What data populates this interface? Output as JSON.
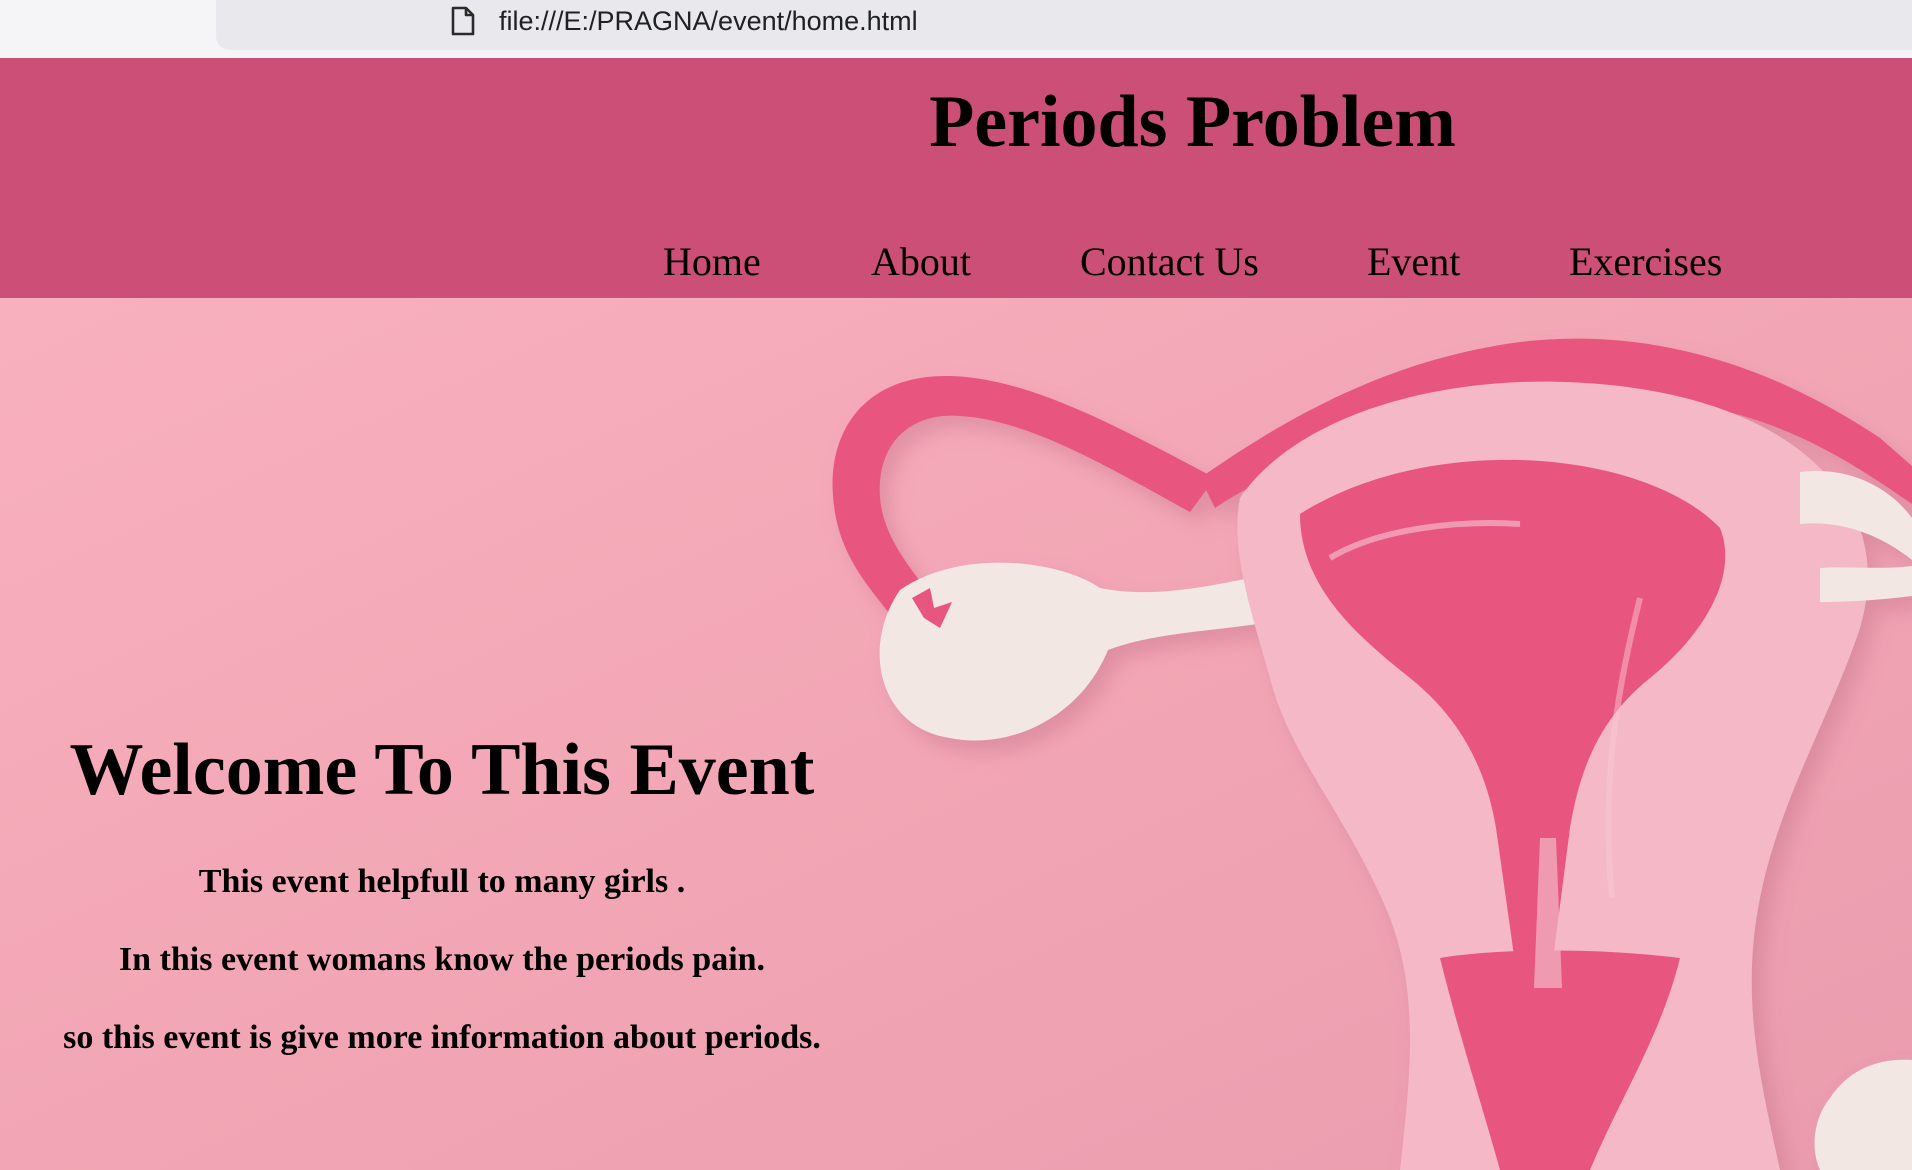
{
  "browser": {
    "url": "file:///E:/PRAGNA/event/home.html",
    "icons": {
      "page": "page-icon"
    }
  },
  "header": {
    "title": "Periods Problem",
    "background_color": "#cb4f77"
  },
  "nav": {
    "items": [
      {
        "label": "Home"
      },
      {
        "label": "About"
      },
      {
        "label": "Contact Us"
      },
      {
        "label": "Event"
      },
      {
        "label": "Exercises"
      }
    ]
  },
  "hero": {
    "heading": "Welcome To This Event",
    "lines": [
      "This event helpfull to many girls .",
      "In this event womans know the periods pain.",
      "so this event is give more information about periods."
    ],
    "background_color": "#f5a8b8",
    "illustration": "paper-cutout-uterus-image"
  }
}
